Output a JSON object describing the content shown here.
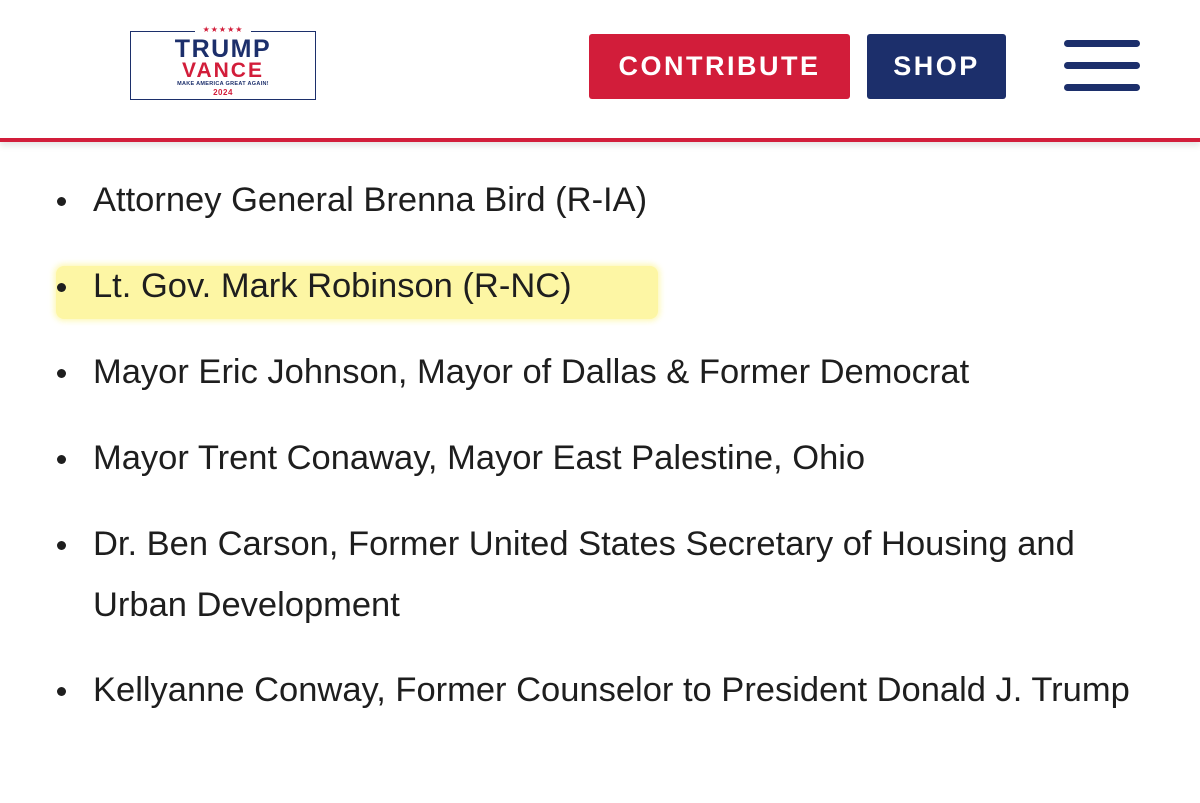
{
  "header": {
    "logo": {
      "stars": "★★★★★",
      "line1": "TRUMP",
      "line2": "VANCE",
      "slogan": "MAKE AMERICA GREAT AGAIN!",
      "year": "2024"
    },
    "contribute_label": "CONTRIBUTE",
    "shop_label": "SHOP",
    "menu_icon": "hamburger-menu-icon"
  },
  "colors": {
    "brand_red": "#d21d3a",
    "brand_navy": "#1c2f6b",
    "highlight": "#fdf6a4",
    "text": "#1e1e1e"
  },
  "endorsements": [
    {
      "text": "Attorney General Brenna Bird (R-IA)",
      "highlighted": false
    },
    {
      "text": "Lt. Gov. Mark Robinson (R-NC)",
      "highlighted": true
    },
    {
      "text": "Mayor Eric Johnson, Mayor of Dallas & Former Democrat",
      "highlighted": false
    },
    {
      "text": "Mayor Trent Conaway, Mayor East Palestine, Ohio",
      "highlighted": false
    },
    {
      "text": "Dr. Ben Carson, Former United States Secretary of Housing and Urban Development",
      "highlighted": false
    },
    {
      "text": "Kellyanne Conway, Former Counselor to President Donald J. Trump",
      "highlighted": false
    }
  ]
}
